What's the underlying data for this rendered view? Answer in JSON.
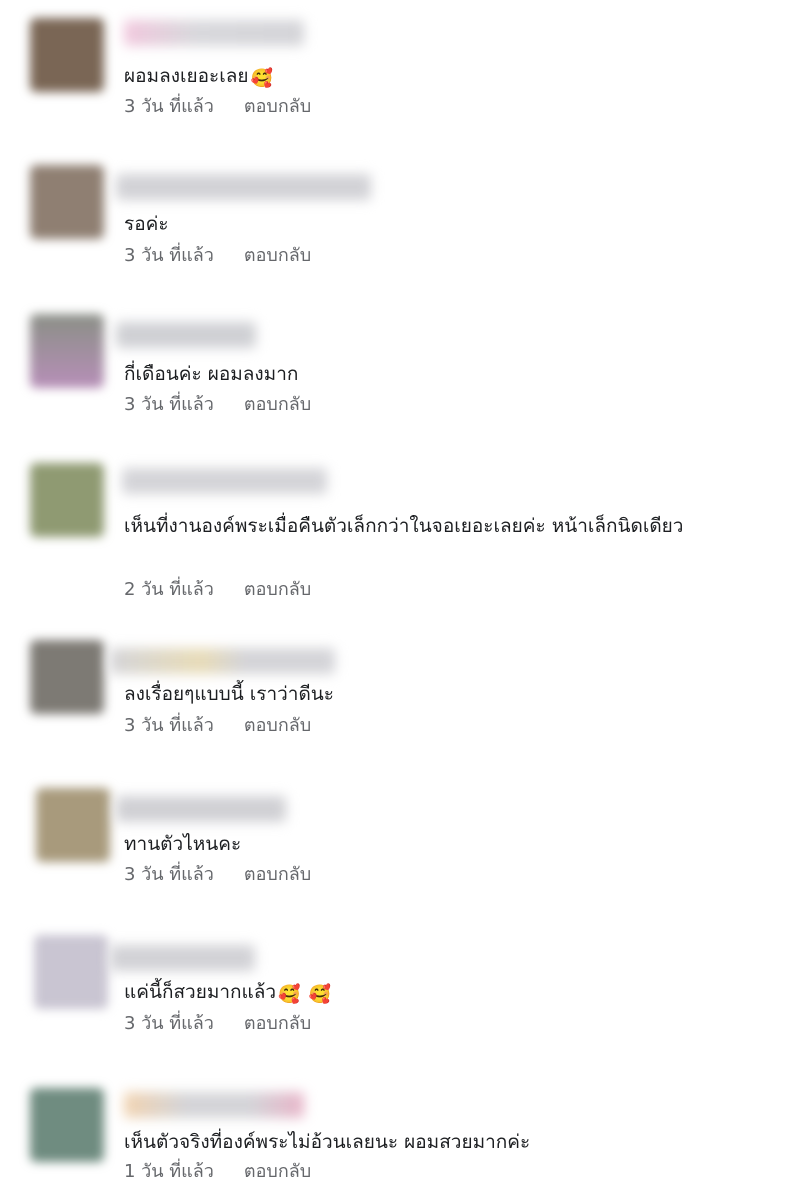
{
  "comments": [
    {
      "text": "ผอมลงเยอะเลย",
      "emojis": [
        "🥰"
      ],
      "time": "3 วัน ที่แล้ว",
      "reply_label": "ตอบกลับ",
      "avatar_color": "#7a6655"
    },
    {
      "text": "รอค่ะ",
      "emojis": [],
      "time": "3 วัน ที่แล้ว",
      "reply_label": "ตอบกลับ",
      "avatar_color": "#8f7f72"
    },
    {
      "text": "กี่เดือนค่ะ ผอมลงมาก",
      "emojis": [],
      "time": "3 วัน ที่แล้ว",
      "reply_label": "ตอบกลับ",
      "avatar_color": "#7e6f7c"
    },
    {
      "text": "เห็นที่งานองค์พระเมื่อคืนตัวเล็กกว่าในจอเยอะเลยค่ะ หน้าเล็กนิดเดียว",
      "emojis": [],
      "time": "2 วัน ที่แล้ว",
      "reply_label": "ตอบกลับ",
      "avatar_color": "#8f9a72"
    },
    {
      "text": "ลงเรื่อยๆแบบนี้ เราว่าดีนะ",
      "emojis": [],
      "time": "3 วัน ที่แล้ว",
      "reply_label": "ตอบกลับ",
      "avatar_color": "#7d7a74"
    },
    {
      "text": "ทานตัวไหนคะ",
      "emojis": [],
      "time": "3 วัน ที่แล้ว",
      "reply_label": "ตอบกลับ",
      "avatar_color": "#a89a7c"
    },
    {
      "text": "แค่นี้ก็สวยมากแล้ว",
      "emojis": [
        "🥰",
        "🥰"
      ],
      "time": "3 วัน ที่แล้ว",
      "reply_label": "ตอบกลับ",
      "avatar_color": "#c9c5d2"
    },
    {
      "text": "เห็นตัวจริงที่องค์พระไม่อ้วนเลยนะ ผอมสวยมากค่ะ",
      "emojis": [],
      "time": "1 วัน ที่แล้ว",
      "reply_label": "ตอบกลับ",
      "avatar_color": "#6f8c80"
    }
  ]
}
